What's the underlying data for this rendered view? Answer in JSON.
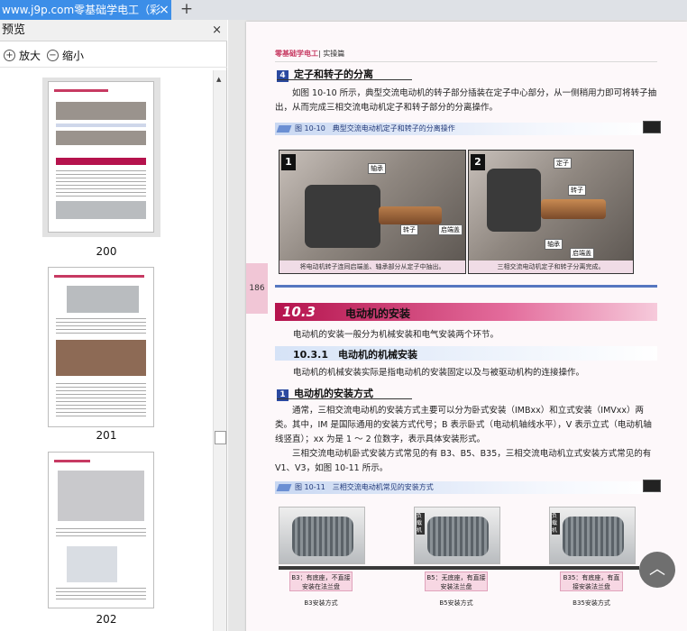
{
  "tab": {
    "title": "www.j9p.com零基础学电工（彩",
    "close": "×",
    "new_tab": "+"
  },
  "preview": {
    "title": "预览",
    "close": "×",
    "zoom_in": "放大",
    "zoom_out": "缩小",
    "thumbnails": [
      {
        "label": "200"
      },
      {
        "label": "201"
      },
      {
        "label": "202"
      }
    ]
  },
  "page": {
    "header_left": "零基础学电工",
    "header_right": "| 实操篇",
    "page_number": "186",
    "s4": {
      "num": "4",
      "title": "定子和转子的分离"
    },
    "p1": "如图 10-10 所示，典型交流电动机的转子部分插装在定子中心部分，从一侧稍用力即可将转子抽出，从而完成三相交流电动机定子和转子部分的分离操作。",
    "fig1": "图 10-10　典型交流电动机定子和转子的分离操作",
    "photo1": {
      "badge": "1",
      "tags": [
        "轴承",
        "转子",
        "启端盖"
      ],
      "caption": "将电动机转子连同启端盖、轴承部分从定子中抽出。"
    },
    "photo2": {
      "badge": "2",
      "tags": [
        "定子",
        "转子",
        "轴承",
        "启端盖"
      ],
      "caption": "三相交流电动机定子和转子分离完成。"
    },
    "section": {
      "number": "10.3",
      "title": "电动机的安装"
    },
    "p2": "电动机的安装一般分为机械安装和电气安装两个环节。",
    "sub": "10.3.1　电动机的机械安装",
    "p3": "电动机的机械安装实际是指电动机的安装固定以及与被驱动机构的连接操作。",
    "s1": {
      "num": "1",
      "title": "电动机的安装方式"
    },
    "p4": "通常，三相交流电动机的安装方式主要可以分为卧式安装（IMBxx）和立式安装（IMVxx）两类。其中，IM 是国际通用的安装方式代号；B 表示卧式（电动机轴线水平），V 表示立式（电动机轴线竖直）；xx 为是 1 ～ 2 位数字，表示具体安装形式。",
    "p5": "三相交流电动机卧式安装方式常见的有 B3、B5、B35，三相交流电动机立式安装方式常见的有 V1、V3，如图 10-11 所示。",
    "fig2": "图 10-11　三相交流电动机常见的安装方式",
    "mounts": [
      {
        "side": "",
        "caption": "B3：有底座，不直接安装在法兰盘",
        "label": "B3安装方式"
      },
      {
        "side": "负载机",
        "caption": "B5：无底座，有直接安装法兰盘",
        "label": "B5安装方式"
      },
      {
        "side": "负载机",
        "caption": "B35：有底座，有直接安装法兰盘",
        "label": "B35安装方式"
      }
    ]
  },
  "scroll_top_icon": "chevron-up-icon"
}
